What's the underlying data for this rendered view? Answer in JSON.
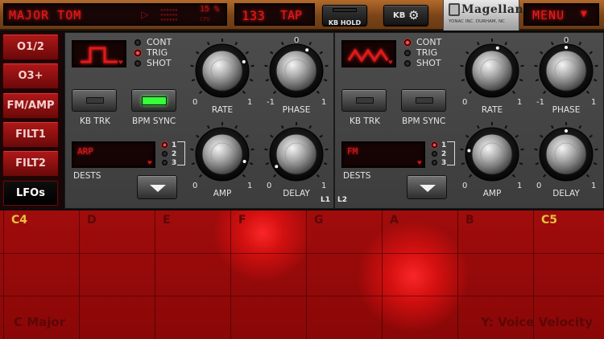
{
  "topbar": {
    "preset_name": "MAJOR TOM",
    "play_icon": "play-icon",
    "cpu_percent": "15 %",
    "cpu_label": "CPU",
    "tempo": "133",
    "tap_label": "TAP",
    "kb_hold_label": "KB HOLD",
    "kb_label": "KB",
    "kb_icon": "gear-icon",
    "logo_text": "Magellan",
    "logo_subtitle": "YONAC INC. DURHAM, NC",
    "menu_label": "MENU",
    "menu_arrow": "▼"
  },
  "sidebar": {
    "items": [
      {
        "label": "O1/2",
        "active": false
      },
      {
        "label": "O3+",
        "active": false
      },
      {
        "label": "FM/AMP",
        "active": false
      },
      {
        "label": "FILT1",
        "active": false
      },
      {
        "label": "FILT2",
        "active": false
      },
      {
        "label": "LFOs",
        "active": true
      }
    ]
  },
  "lfo1": {
    "id_label": "L1",
    "waveform": "square",
    "modes": [
      "CONT",
      "TRIG",
      "SHOT"
    ],
    "selected_mode": "TRIG",
    "kb_trk_label": "KB TRK",
    "bpm_sync_label": "BPM SYNC",
    "bpm_sync_on": true,
    "dests_label": "DESTS",
    "dest_value": "ARP",
    "dest_slots": [
      "1",
      "2",
      "3"
    ],
    "dest_selected": "1",
    "knobs": {
      "rate": {
        "label": "RATE",
        "min": "0",
        "max": "1",
        "value": 0.75
      },
      "phase": {
        "label": "PHASE",
        "min": "-1",
        "max": "1",
        "top": "0",
        "value": 0.6
      },
      "amp": {
        "label": "AMP",
        "min": "0",
        "max": "1",
        "value": 0.9
      },
      "delay": {
        "label": "DELAY",
        "min": "0",
        "max": "1",
        "value": 0.05
      }
    }
  },
  "lfo2": {
    "id_label": "L2",
    "waveform": "triangle",
    "modes": [
      "CONT",
      "TRIG",
      "SHOT"
    ],
    "selected_mode": "CONT",
    "kb_trk_label": "KB TRK",
    "bpm_sync_label": "BPM SYNC",
    "bpm_sync_on": false,
    "dests_label": "DESTS",
    "dest_value": "FM",
    "dest_slots": [
      "1",
      "2",
      "3"
    ],
    "dest_selected": "1",
    "knobs": {
      "rate": {
        "label": "RATE",
        "min": "0",
        "max": "1",
        "value": 0.55
      },
      "phase": {
        "label": "PHASE",
        "min": "-1",
        "max": "1",
        "top": "0",
        "value": 0.5
      },
      "amp": {
        "label": "AMP",
        "min": "0",
        "max": "1",
        "value": 0.2
      },
      "delay": {
        "label": "DELAY",
        "min": "0",
        "max": "1",
        "value": 0.5
      }
    }
  },
  "grid": {
    "notes": [
      "C4",
      "D",
      "E",
      "F",
      "G",
      "A",
      "B",
      "C5"
    ],
    "scale_label": "C Major",
    "y_axis_label": "Y: Voice Velocity"
  }
}
